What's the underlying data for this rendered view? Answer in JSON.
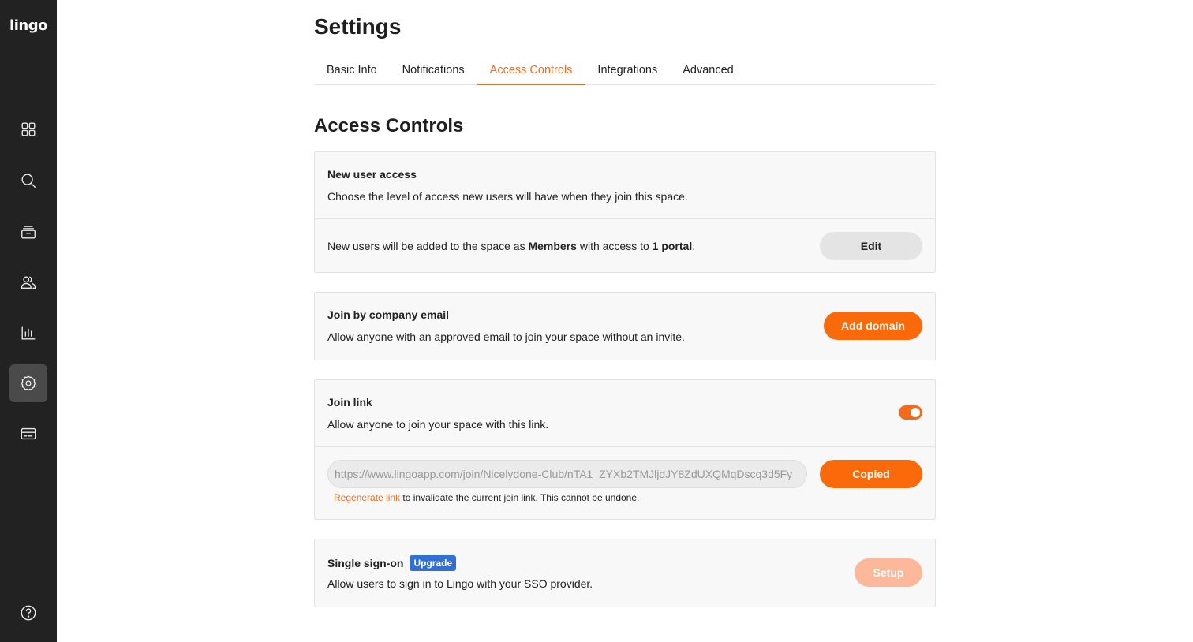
{
  "app": {
    "logo": "lingo"
  },
  "sidebar": {
    "items": [
      {
        "name": "dashboard",
        "icon": "grid-icon"
      },
      {
        "name": "search",
        "icon": "search-icon"
      },
      {
        "name": "library",
        "icon": "archive-icon"
      },
      {
        "name": "users",
        "icon": "users-icon"
      },
      {
        "name": "analytics",
        "icon": "bar-chart-icon"
      },
      {
        "name": "settings",
        "icon": "gear-icon",
        "active": true
      },
      {
        "name": "billing",
        "icon": "credit-card-icon"
      },
      {
        "name": "help",
        "icon": "help-icon"
      }
    ]
  },
  "page": {
    "title": "Settings"
  },
  "tabs": [
    {
      "label": "Basic Info",
      "active": false
    },
    {
      "label": "Notifications",
      "active": false
    },
    {
      "label": "Access Controls",
      "active": true
    },
    {
      "label": "Integrations",
      "active": false
    },
    {
      "label": "Advanced",
      "active": false
    }
  ],
  "section": {
    "title": "Access Controls"
  },
  "new_user_access": {
    "title": "New user access",
    "description": "Choose the level of access new users will have when they join this space.",
    "summary_prefix": "New users will be added to the space as ",
    "summary_role": "Members",
    "summary_middle": " with access to ",
    "summary_portals": "1 portal",
    "summary_suffix": ".",
    "edit_label": "Edit"
  },
  "company_email": {
    "title": "Join by company email",
    "description": "Allow anyone with an approved email to join your space without an invite.",
    "button_label": "Add domain"
  },
  "join_link": {
    "title": "Join link",
    "description": "Allow anyone to join your space with this link.",
    "enabled": true,
    "url": "https://www.lingoapp.com/join/Nicelydone-Club/nTA1_ZYXb2TMJljdJY8ZdUXQMqDscq3d5Fy",
    "copy_label": "Copied",
    "regenerate_label": "Regenerate link",
    "regenerate_note": " to invalidate the current join link. This cannot be undone."
  },
  "sso": {
    "title": "Single sign-on",
    "badge": "Upgrade",
    "description": "Allow users to sign in to Lingo with your SSO provider.",
    "button_label": "Setup"
  },
  "colors": {
    "accent": "#f26a1b",
    "sidebar_bg": "#222222",
    "badge_blue": "#2f6fd6"
  }
}
